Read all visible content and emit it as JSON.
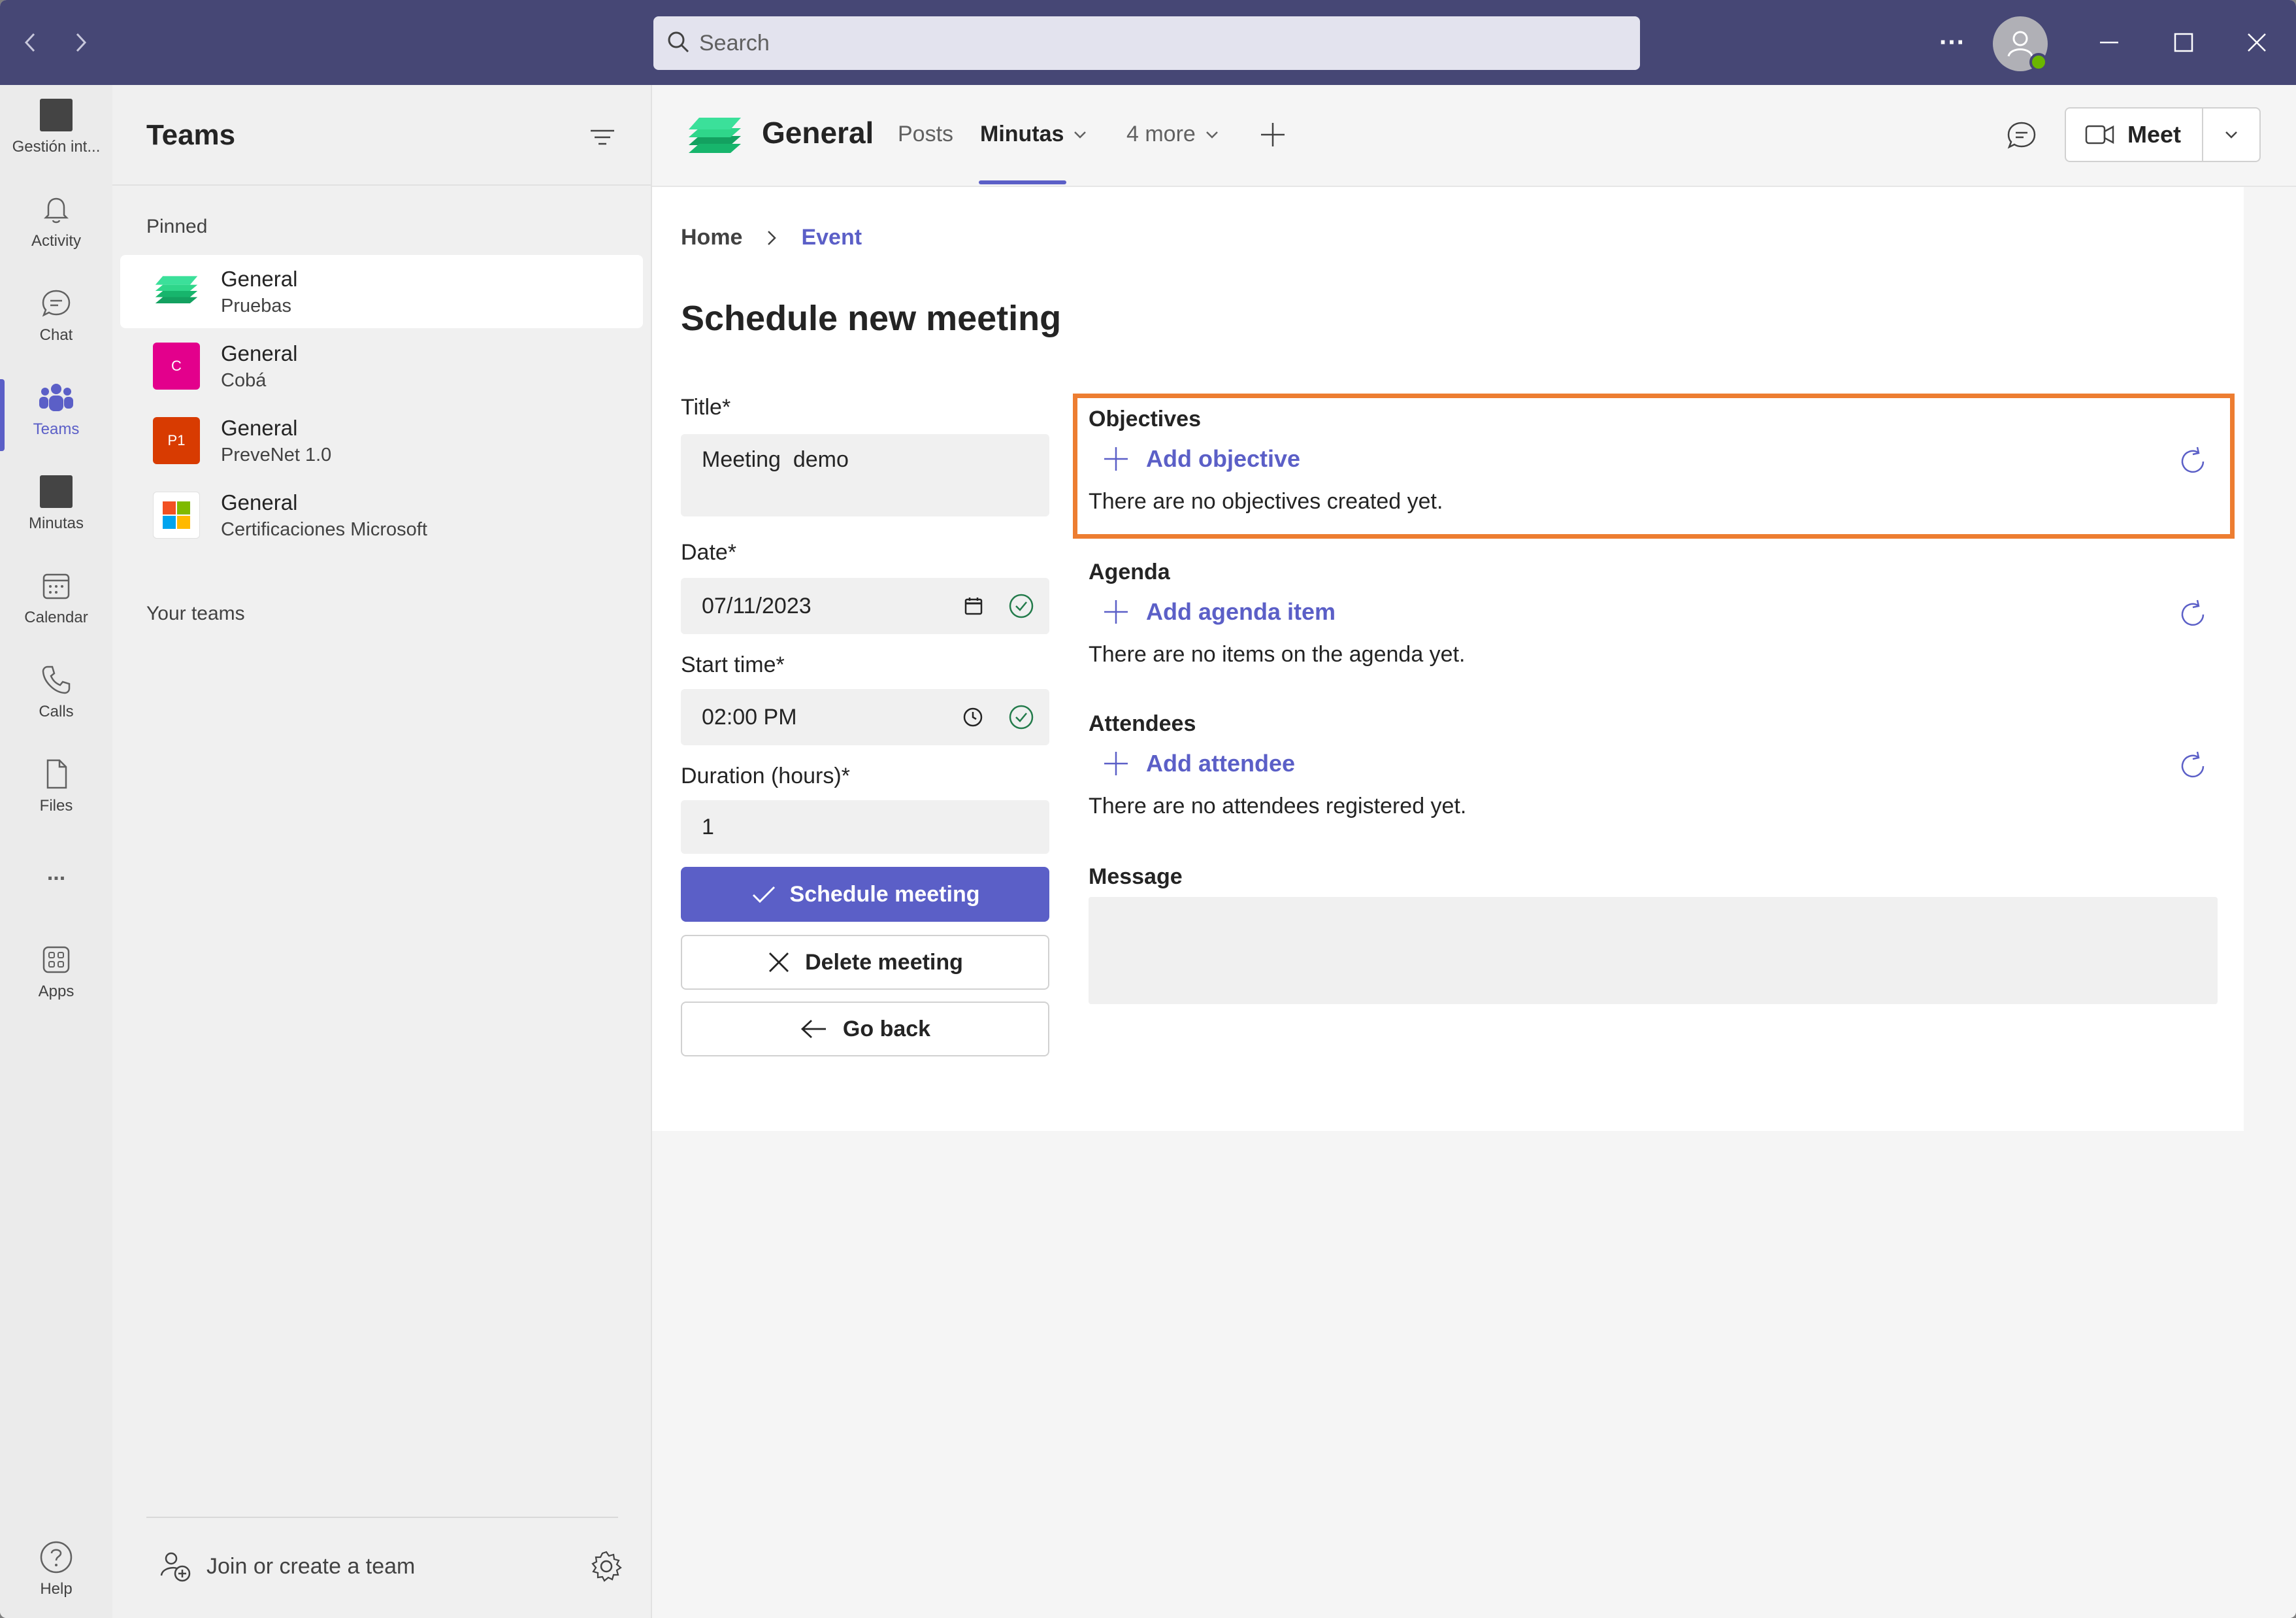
{
  "titlebar": {
    "search_placeholder": "Search",
    "more_label": "···"
  },
  "rail": {
    "items": [
      {
        "label": "Gestión int..."
      },
      {
        "label": "Activity"
      },
      {
        "label": "Chat"
      },
      {
        "label": "Teams"
      },
      {
        "label": "Minutas"
      },
      {
        "label": "Calendar"
      },
      {
        "label": "Calls"
      },
      {
        "label": "Files"
      },
      {
        "label": "..."
      },
      {
        "label": "Apps"
      }
    ],
    "help_label": "Help"
  },
  "teams_pane": {
    "title": "Teams",
    "pinned_label": "Pinned",
    "your_teams_label": "Your teams",
    "teams": [
      {
        "name": "General",
        "sub": "Pruebas",
        "logo_color": "#22c07a"
      },
      {
        "name": "General",
        "sub": "Cobá",
        "logo_color": "#e3008c",
        "logo_text": "C"
      },
      {
        "name": "General",
        "sub": "PreveNet 1.0",
        "logo_color": "#d83b01",
        "logo_text": "P1"
      },
      {
        "name": "General",
        "sub": "Certificaciones Microsoft",
        "logo_color": "#ffffff"
      }
    ],
    "join_label": "Join or create a team"
  },
  "channel_header": {
    "title": "General",
    "tabs": [
      {
        "label": "Posts"
      },
      {
        "label": "Minutas"
      },
      {
        "label": "4 more"
      }
    ],
    "meet_label": "Meet"
  },
  "page": {
    "breadcrumb_home": "Home",
    "breadcrumb_current": "Event",
    "title": "Schedule new meeting",
    "title_label": "Title*",
    "title_value": "Meeting  demo",
    "date_label": "Date*",
    "date_value": "07/11/2023",
    "start_label": "Start time*",
    "start_value": "02:00 PM",
    "duration_label": "Duration (hours)*",
    "duration_value": "1",
    "schedule_button": "Schedule meeting",
    "delete_button": "Delete meeting",
    "back_button": "Go back"
  },
  "sections": {
    "objectives": {
      "title": "Objectives",
      "add_label": "Add objective",
      "empty": "There are no objectives created yet."
    },
    "agenda": {
      "title": "Agenda",
      "add_label": "Add agenda item",
      "empty": "There are no items on the agenda yet."
    },
    "attendees": {
      "title": "Attendees",
      "add_label": "Add attendee",
      "empty": "There are no attendees registered yet."
    },
    "message": {
      "title": "Message"
    }
  },
  "colors": {
    "titlebar": "#464775",
    "accent": "#5b5fc7",
    "highlight": "#ed7d31",
    "presence": "#6bb700"
  }
}
